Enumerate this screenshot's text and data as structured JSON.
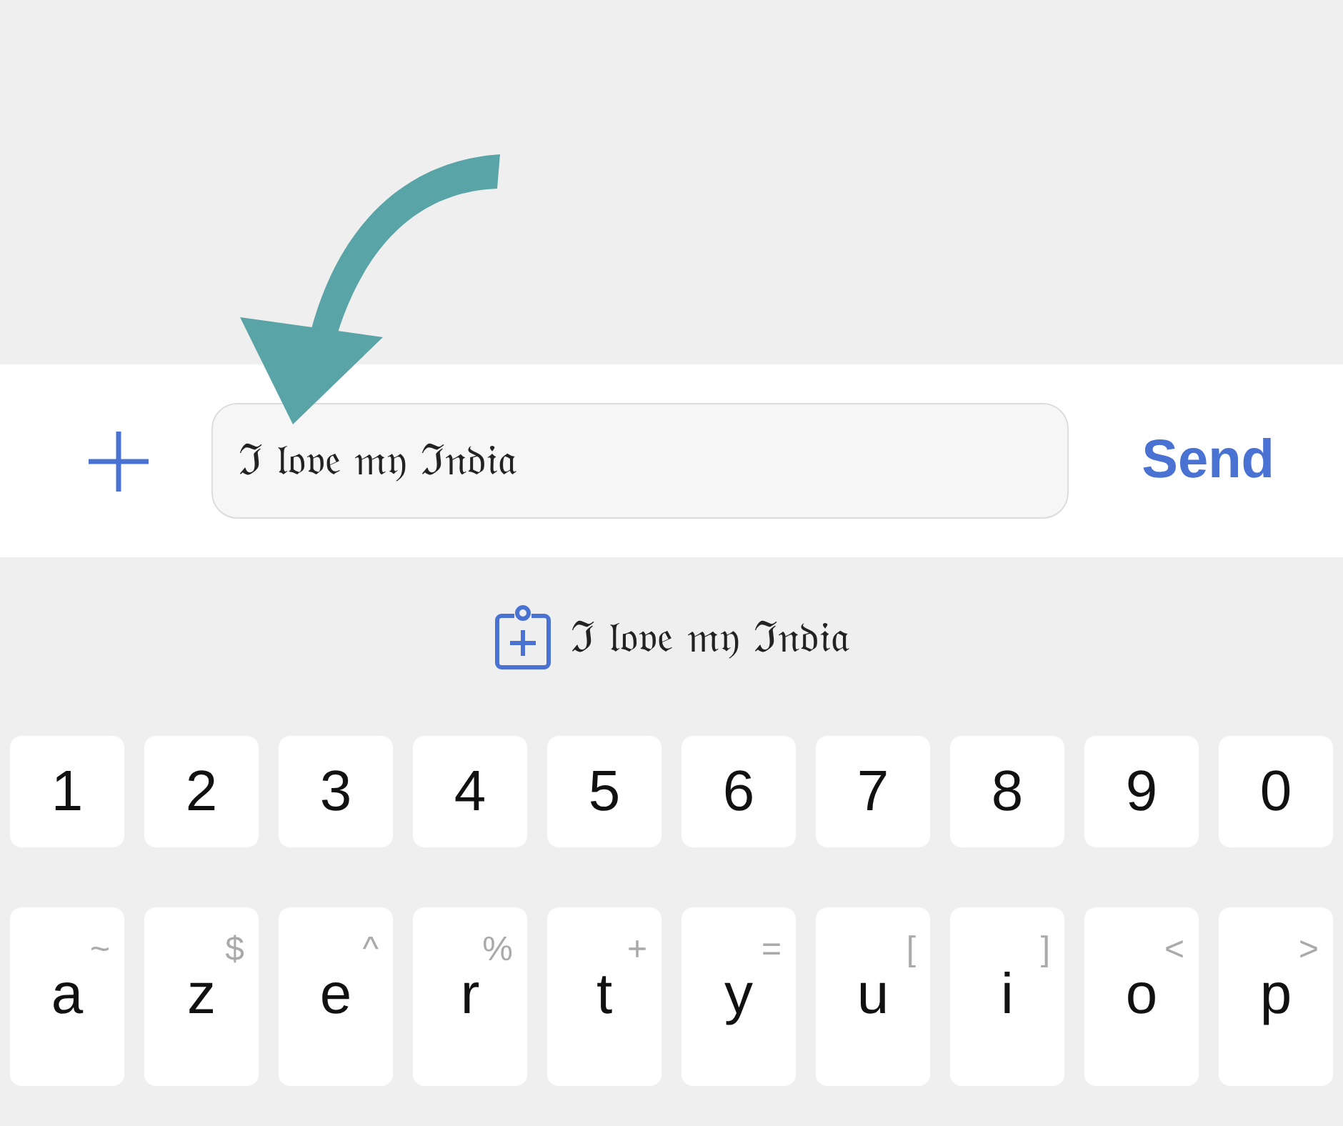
{
  "composer": {
    "value": "ℑ 𝔩𝔬𝔳𝔢 𝔪𝔶 ℑ𝔫𝔡𝔦𝔞",
    "send": "Send"
  },
  "suggestion": {
    "text": "ℑ 𝔩𝔬𝔳𝔢 𝔪𝔶 ℑ𝔫𝔡𝔦𝔞"
  },
  "rows": [
    {
      "keys": [
        {
          "label": "1"
        },
        {
          "label": "2"
        },
        {
          "label": "3"
        },
        {
          "label": "4"
        },
        {
          "label": "5"
        },
        {
          "label": "6"
        },
        {
          "label": "7"
        },
        {
          "label": "8"
        },
        {
          "label": "9"
        },
        {
          "label": "0"
        }
      ]
    },
    {
      "keys": [
        {
          "label": "a",
          "hint": "~"
        },
        {
          "label": "z",
          "hint": "$"
        },
        {
          "label": "e",
          "hint": "^"
        },
        {
          "label": "r",
          "hint": "%"
        },
        {
          "label": "t",
          "hint": "+"
        },
        {
          "label": "y",
          "hint": "="
        },
        {
          "label": "u",
          "hint": "["
        },
        {
          "label": "i",
          "hint": "]"
        },
        {
          "label": "o",
          "hint": "<"
        },
        {
          "label": "p",
          "hint": ">"
        }
      ]
    }
  ]
}
